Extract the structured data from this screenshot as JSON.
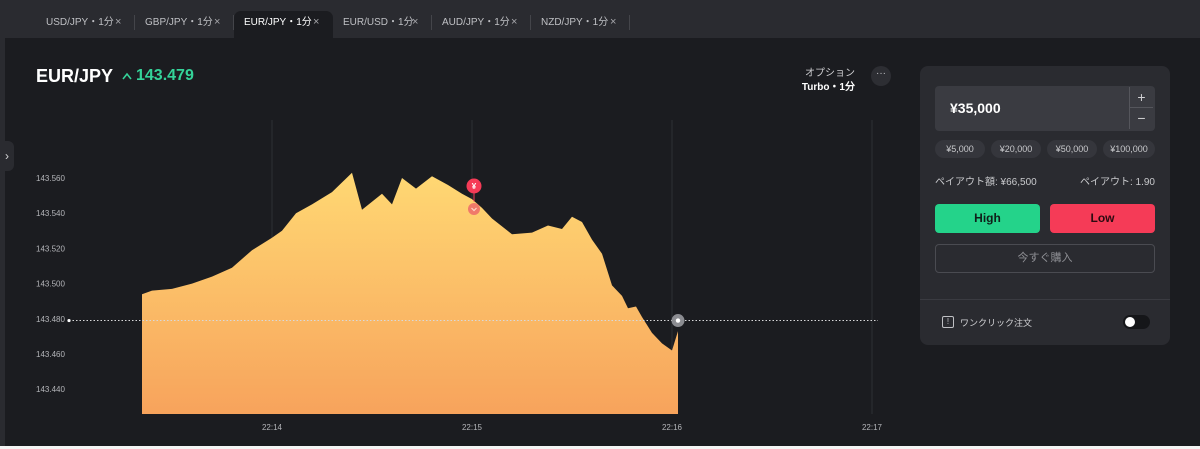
{
  "tabs": [
    {
      "label": "USD/JPY・1分",
      "active": false
    },
    {
      "label": "GBP/JPY・1分",
      "active": false
    },
    {
      "label": "EUR/JPY・1分",
      "active": true
    },
    {
      "label": "EUR/USD・1分",
      "active": false
    },
    {
      "label": "AUD/JPY・1分",
      "active": false
    },
    {
      "label": "NZD/JPY・1分",
      "active": false
    }
  ],
  "tab_close_glyph": "×",
  "header": {
    "pair": "EUR/JPY",
    "price": "143.479",
    "price_direction_icon": "up-chevron-icon",
    "price_color": "#34d399",
    "option_label": "オプション",
    "option_value": "Turbo・1分",
    "more_label": "···"
  },
  "panel": {
    "amount": "¥35,000",
    "plus": "+",
    "minus": "−",
    "presets": [
      "¥5,000",
      "¥20,000",
      "¥50,000",
      "¥100,000"
    ],
    "payout_amount": "ペイアウト額: ¥66,500",
    "payout_rate": "ペイアウト: 1.90",
    "high_label": "High",
    "low_label": "Low",
    "buy_label": "今すぐ購入",
    "one_click_label": "ワンクリック注文",
    "one_click_enabled": false,
    "colors": {
      "high": "#24d38a",
      "low": "#f53b57"
    }
  },
  "chart_data": {
    "type": "area",
    "x_unit": "minutes",
    "xticks": [
      "22:14",
      "22:15",
      "22:16",
      "22:17"
    ],
    "yticks": [
      "143.560",
      "143.540",
      "143.520",
      "143.500",
      "143.480",
      "143.460",
      "143.440"
    ],
    "ylim": [
      143.431,
      143.582
    ],
    "current_price": 143.479,
    "current_price_line": true,
    "gradient": [
      "#ffd873",
      "#f7a35c"
    ],
    "marker": {
      "label": "¥",
      "time": "22:15",
      "price": 143.558,
      "color": "#f53b57"
    },
    "series": [
      {
        "x": [
          "22:13.35",
          "22:13.40",
          "22:13.50",
          "22:13.60",
          "22:13.70",
          "22:13.80",
          "22:13.90",
          "22:14.00",
          "22:14.05",
          "22:14.12",
          "22:14.20",
          "22:14.30",
          "22:14.40",
          "22:14.45",
          "22:14.55",
          "22:14.60",
          "22:14.65",
          "22:14.72",
          "22:14.80",
          "22:14.88",
          "22:14.95",
          "22:15.00",
          "22:15.05",
          "22:15.10",
          "22:15.20",
          "22:15.30",
          "22:15.38",
          "22:15.45",
          "22:15.50",
          "22:15.55",
          "22:15.60",
          "22:15.65",
          "22:15.70",
          "22:15.75",
          "22:15.78",
          "22:15.82",
          "22:15.85",
          "22:15.90",
          "22:15.95",
          "22:16.00",
          "22:16.03"
        ],
        "y": [
          143.494,
          143.496,
          143.497,
          143.5,
          143.504,
          143.509,
          143.519,
          143.526,
          143.53,
          143.54,
          143.545,
          143.552,
          143.563,
          143.542,
          143.551,
          143.545,
          143.56,
          143.554,
          143.561,
          143.556,
          143.551,
          143.548,
          143.543,
          143.537,
          143.528,
          143.529,
          143.533,
          143.531,
          143.538,
          143.535,
          143.525,
          143.517,
          143.499,
          143.493,
          143.486,
          143.487,
          143.481,
          143.472,
          143.466,
          143.462,
          143.473
        ]
      }
    ]
  }
}
